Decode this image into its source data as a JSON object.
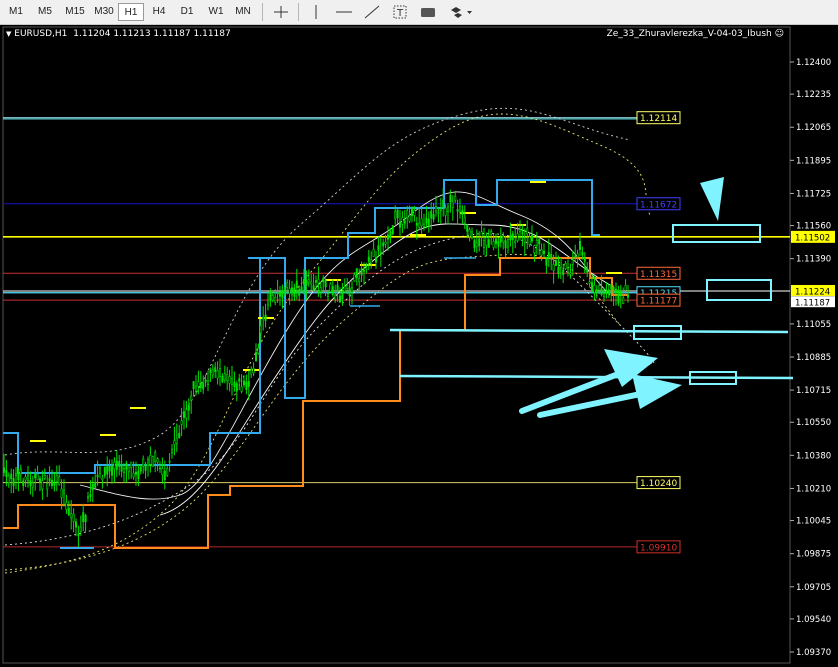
{
  "toolbar": {
    "timeframes": [
      "M1",
      "M5",
      "M15",
      "M30",
      "H1",
      "H4",
      "D1",
      "W1",
      "MN"
    ],
    "active": "H1"
  },
  "header": {
    "symbol": "EURUSD,H1",
    "ohlc": "1.11204 1.11213 1.11187 1.11187",
    "indicator": "Ze_33_Zhuravlerezka_V-04-03_Ibush"
  },
  "price_axis": {
    "ticks": [
      "1.12400",
      "1.12235",
      "1.12065",
      "1.11895",
      "1.11725",
      "1.11560",
      "1.11390",
      "1.11224",
      "1.11187",
      "1.11055",
      "1.10885",
      "1.10715",
      "1.10550",
      "1.10380",
      "1.10210",
      "1.10045",
      "1.09875",
      "1.09705",
      "1.09540",
      "1.09370"
    ],
    "current_price": "1.11224",
    "current_bid": "1.11187",
    "horizontal_line": "1.11502"
  },
  "level_tags": [
    {
      "text": "1.12114",
      "color": "#ffff66"
    },
    {
      "text": "1.11672",
      "color": "#4040ff"
    },
    {
      "text": "1.11315",
      "color": "#ff6a3a"
    },
    {
      "text": "1.11215",
      "color": "#50e0ff"
    },
    {
      "text": "1.11177",
      "color": "#ff6a3a"
    },
    {
      "text": "1.10240",
      "color": "#ffff66"
    },
    {
      "text": "1.09910",
      "color": "#d03030"
    }
  ],
  "colors": {
    "candle": "#00e000",
    "teal_channel": "#33aaee",
    "orange_channel": "#ff8c1a",
    "yellow_line": "#ffff00",
    "annotation": "#7ff3ff"
  }
}
